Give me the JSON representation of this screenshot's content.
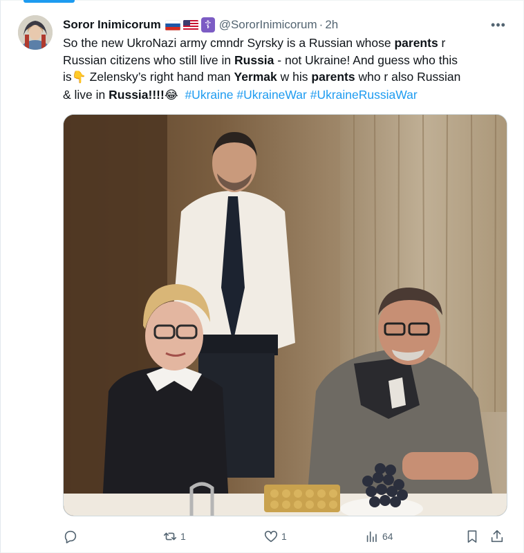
{
  "tweet": {
    "display_name": "Soror Inimicorum",
    "badges": [
      "russia-flag-icon",
      "us-flag-icon",
      "orthodox-cross-icon"
    ],
    "handle": "@SororInimicorum",
    "separator": "·",
    "time": "2h",
    "more_label": "•••",
    "text": {
      "line1_a": "So the new  UkroNazi army cmndr Syrsky is a Russian whose ",
      "line1_b": "parents",
      "line1_c": " r",
      "line2_a": "Russian citizens who still live in ",
      "line2_b": "Russia",
      "line2_c": " - not Ukraine! And guess who this",
      "line3_a": "is",
      "line3_emoji": "👇",
      "line3_b": " Zelensky’s right hand man ",
      "line3_c": "Yermak",
      "line3_d": " w his ",
      "line3_e": "parents",
      "line3_f": " who r also Russian",
      "line4_a": "& live in ",
      "line4_b": "Russia",
      "line4_c": "!!!!",
      "line4_emoji": "😂",
      "hashtags": [
        "#Ukraine",
        "#UkraineWar",
        "#UkraineRussiaWar"
      ]
    },
    "media_icon": "photo-three-people-at-table",
    "actions": {
      "reply": {
        "icon": "reply-icon",
        "count": ""
      },
      "retweet": {
        "icon": "retweet-icon",
        "count": "1"
      },
      "like": {
        "icon": "heart-icon",
        "count": "1"
      },
      "views": {
        "icon": "views-icon",
        "count": "64"
      },
      "bookmark": {
        "icon": "bookmark-icon",
        "count": ""
      },
      "share": {
        "icon": "share-icon",
        "count": ""
      }
    }
  },
  "colors": {
    "accent": "#1d9bf0",
    "text": "#0f1419",
    "muted": "#536471"
  }
}
